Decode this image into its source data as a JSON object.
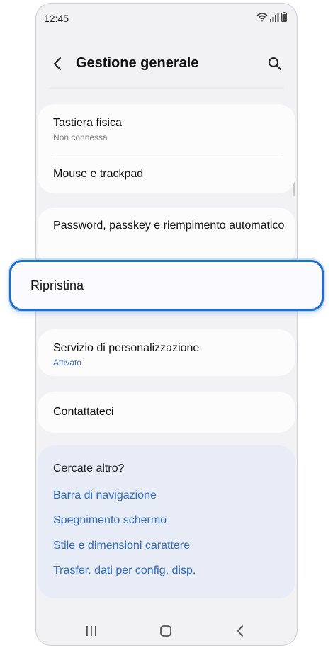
{
  "status_bar": {
    "time": "12:45",
    "icons": [
      "wifi-icon",
      "signal-icon",
      "battery-icon"
    ]
  },
  "header": {
    "title": "Gestione generale",
    "back_icon": "chevron-left-icon",
    "search_icon": "search-icon"
  },
  "group1": {
    "items": [
      {
        "title": "Tastiera fisica",
        "subtitle": "Non connessa"
      },
      {
        "title": "Mouse e trackpad"
      }
    ]
  },
  "group2": {
    "title": "Password, passkey e riempimento automatico"
  },
  "highlight": {
    "title": "Ripristina"
  },
  "group3": {
    "title": "Servizio di personalizzazione",
    "subtitle": "Attivato"
  },
  "group4": {
    "title": "Contattateci"
  },
  "more": {
    "title": "Cercate altro?",
    "links": [
      "Barra di navigazione",
      "Spegnimento schermo",
      "Stile e dimensioni carattere",
      "Trasfer. dati per config. disp."
    ]
  },
  "nav": {
    "icons": [
      "recent-apps-icon",
      "home-icon",
      "back-icon"
    ]
  },
  "colors": {
    "accent": "#1e6fcd",
    "link": "#2f6bc2",
    "subtitle_active": "#3d6fc4",
    "background": "#f2f2f4",
    "suggestion_card": "#e7ecf7"
  }
}
